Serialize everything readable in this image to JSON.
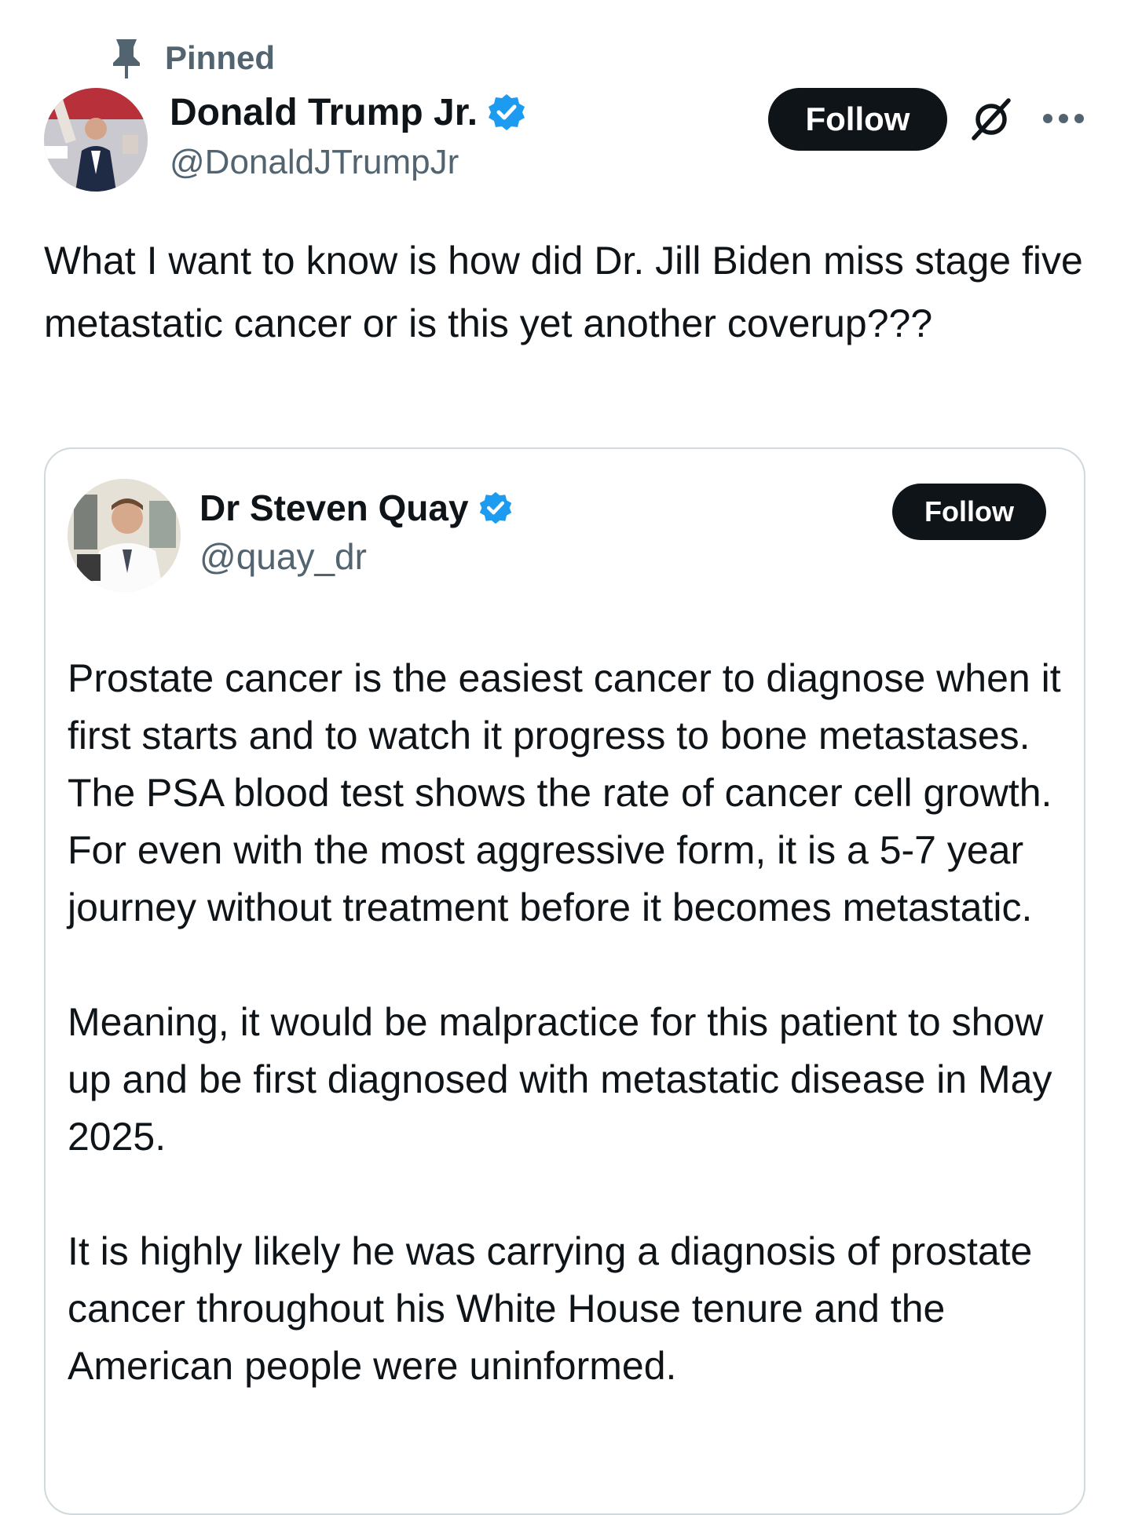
{
  "pinned": {
    "label": "Pinned",
    "icon": "pin-icon"
  },
  "author": {
    "name": "Donald Trump Jr.",
    "handle": "@DonaldJTrumpJr",
    "verified": true,
    "avatar_icon": "avatar"
  },
  "actions": {
    "follow_label": "Follow",
    "grok_icon": "grok-icon",
    "more_icon": "more-options-icon"
  },
  "tweet": {
    "text": "What I want to know is how did Dr. Jill Biden miss stage five metastatic cancer or is this yet another coverup???"
  },
  "quoted": {
    "name": "Dr Steven Quay",
    "handle": "@quay_dr",
    "verified": true,
    "follow_label": "Follow",
    "paragraphs": [
      "Prostate cancer is the easiest cancer to diagnose when it first starts and to watch it progress to bone metastases. The PSA blood test shows the rate of cancer cell growth. For even with the most aggressive form, it is a 5-7 year journey without treatment before it becomes metastatic.",
      "Meaning, it would be malpractice for this patient to show up and be first diagnosed with metastatic disease in May 2025.",
      "It is highly likely he was carrying a diagnosis of prostate cancer throughout his White House tenure and the American people were uninformed."
    ]
  },
  "colors": {
    "text_primary": "#0f1419",
    "text_secondary": "#536471",
    "verified_blue": "#1d9bf0",
    "button_bg": "#0f1419",
    "border": "#cfd9de"
  }
}
